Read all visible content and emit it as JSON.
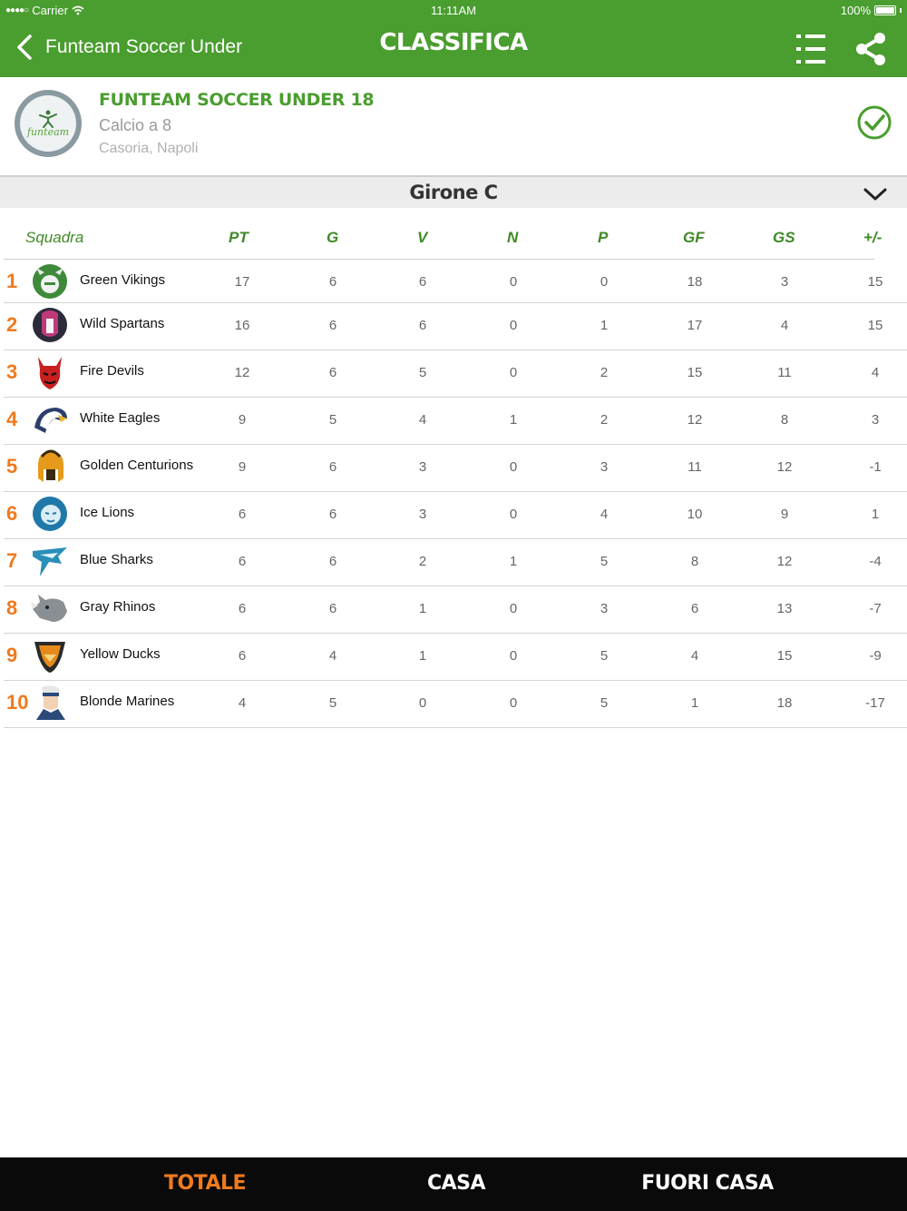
{
  "status": {
    "carrier": "Carrier",
    "time": "11:11AM",
    "battery": "100%"
  },
  "nav": {
    "back_label": "Funteam Soccer Under",
    "title": "CLASSIFICA"
  },
  "team": {
    "name": "FUNTEAM SOCCER UNDER 18",
    "sport": "Calcio a 8",
    "city": "Casoria, Napoli",
    "logo_text": "funteam"
  },
  "group": {
    "label": "Girone C"
  },
  "table": {
    "headers": {
      "team": "Squadra",
      "pt": "PT",
      "g": "G",
      "v": "V",
      "n": "N",
      "p": "P",
      "gf": "GF",
      "gs": "GS",
      "diff": "+/-"
    },
    "rows": [
      {
        "pos": "1",
        "team": "Green Vikings",
        "pt": "17",
        "g": "6",
        "v": "6",
        "n": "0",
        "p": "0",
        "gf": "18",
        "gs": "3",
        "diff": "15",
        "color": "#3f8a3a",
        "icon": "viking"
      },
      {
        "pos": "2",
        "team": "Wild Spartans",
        "pt": "16",
        "g": "6",
        "v": "6",
        "n": "0",
        "p": "1",
        "gf": "17",
        "gs": "4",
        "diff": "15",
        "color": "#c0397a",
        "icon": "spartan"
      },
      {
        "pos": "3",
        "team": "Fire Devils",
        "pt": "12",
        "g": "6",
        "v": "5",
        "n": "0",
        "p": "2",
        "gf": "15",
        "gs": "11",
        "diff": "4",
        "color": "#c8201e",
        "icon": "devil"
      },
      {
        "pos": "4",
        "team": "White Eagles",
        "pt": "9",
        "g": "5",
        "v": "4",
        "n": "1",
        "p": "2",
        "gf": "12",
        "gs": "8",
        "diff": "3",
        "color": "#2c3e6a",
        "icon": "eagle"
      },
      {
        "pos": "5",
        "team": "Golden Centurions",
        "pt": "9",
        "g": "6",
        "v": "3",
        "n": "0",
        "p": "3",
        "gf": "11",
        "gs": "12",
        "diff": "-1",
        "color": "#e59a1a",
        "icon": "centurion"
      },
      {
        "pos": "6",
        "team": "Ice Lions",
        "pt": "6",
        "g": "6",
        "v": "3",
        "n": "0",
        "p": "4",
        "gf": "10",
        "gs": "9",
        "diff": "1",
        "color": "#1f78a8",
        "icon": "lion"
      },
      {
        "pos": "7",
        "team": "Blue Sharks",
        "pt": "6",
        "g": "6",
        "v": "2",
        "n": "1",
        "p": "5",
        "gf": "8",
        "gs": "12",
        "diff": "-4",
        "color": "#2a8fb8",
        "icon": "shark"
      },
      {
        "pos": "8",
        "team": "Gray Rhinos",
        "pt": "6",
        "g": "6",
        "v": "1",
        "n": "0",
        "p": "3",
        "gf": "6",
        "gs": "13",
        "diff": "-7",
        "color": "#8a8f93",
        "icon": "rhino"
      },
      {
        "pos": "9",
        "team": "Yellow Ducks",
        "pt": "6",
        "g": "4",
        "v": "1",
        "n": "0",
        "p": "5",
        "gf": "4",
        "gs": "15",
        "diff": "-9",
        "color": "#e58a1a",
        "icon": "duck"
      },
      {
        "pos": "10",
        "team": "Blonde Marines",
        "pt": "4",
        "g": "5",
        "v": "0",
        "n": "0",
        "p": "5",
        "gf": "1",
        "gs": "18",
        "diff": "-17",
        "color": "#2b4a7a",
        "icon": "marine"
      }
    ]
  },
  "tabs": [
    {
      "label": "TOTALE",
      "active": true
    },
    {
      "label": "CASA",
      "active": false
    },
    {
      "label": "FUORI CASA",
      "active": false
    }
  ],
  "colors": {
    "brand": "#4a9d2f",
    "accent": "#ef7a1e",
    "tabbar": "#0a0a0a"
  }
}
